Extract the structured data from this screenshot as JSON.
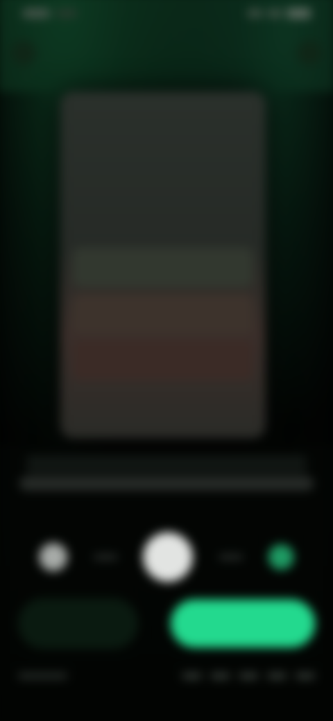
{
  "status_bar": {},
  "top_bar": {
    "title": ""
  },
  "preview": {
    "rows": [
      {
        "label": ""
      },
      {
        "label": ""
      },
      {
        "label": ""
      },
      {
        "label": ""
      },
      {
        "label": ""
      },
      {
        "label": ""
      },
      {
        "label": ""
      }
    ]
  },
  "timeline": {
    "start_label": "",
    "end_label": ""
  },
  "actions": {
    "secondary_label": "",
    "primary_label": ""
  },
  "colors": {
    "accent": "#23d98e",
    "background": "#030604",
    "preview_warm": "#3a2e2a"
  },
  "icons": {
    "back": "chevron-left-icon",
    "menu": "more-icon",
    "play": "play-icon",
    "prev": "prev-icon",
    "next": "next-icon"
  }
}
